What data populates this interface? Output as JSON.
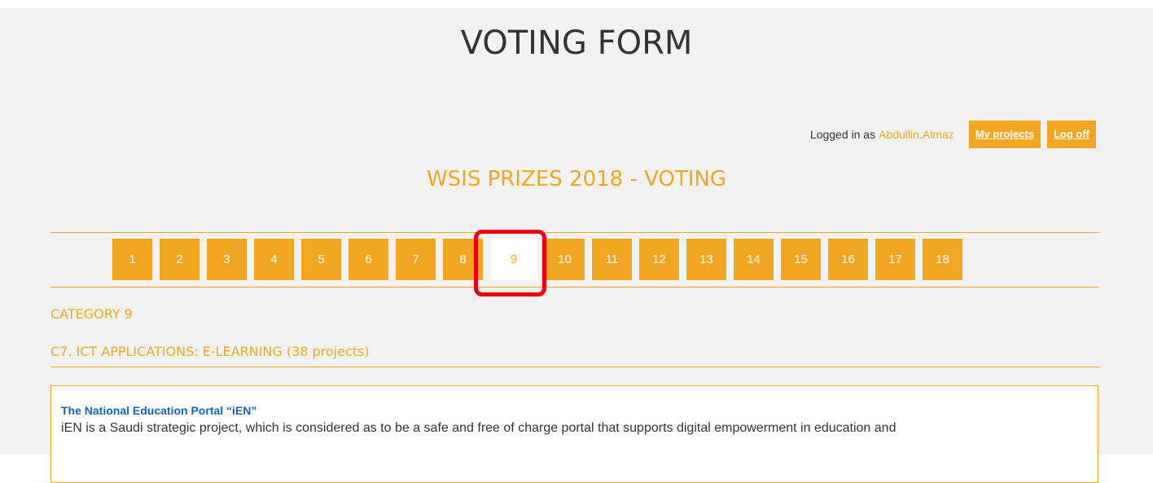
{
  "banner": {
    "fragment": "‘’ ‘’"
  },
  "header": {
    "title": "VOTING FORM"
  },
  "login": {
    "prefix": "Logged in as",
    "username": "Abdullin.Almaz",
    "my_projects_label": "My projects",
    "log_off_label": "Log off"
  },
  "section": {
    "title": "WSIS PRIZES 2018 - VOTING"
  },
  "pager": {
    "pages": [
      "1",
      "2",
      "3",
      "4",
      "5",
      "6",
      "7",
      "8",
      "9",
      "10",
      "11",
      "12",
      "13",
      "14",
      "15",
      "16",
      "17",
      "18"
    ],
    "active": "9"
  },
  "category": {
    "label": "CATEGORY 9",
    "subtitle": "C7. ICT APPLICATIONS: E-LEARNING (38 projects)"
  },
  "project": {
    "title": "The National Education Portal “iEN”",
    "description": "iEN is a Saudi strategic project, which is considered as to be a safe and free of charge portal that supports digital empowerment in education and"
  },
  "colors": {
    "accent": "#f0a523",
    "highlight": "#e8000b",
    "link": "#1565b0",
    "panel_bg": "#f2f2f2"
  }
}
